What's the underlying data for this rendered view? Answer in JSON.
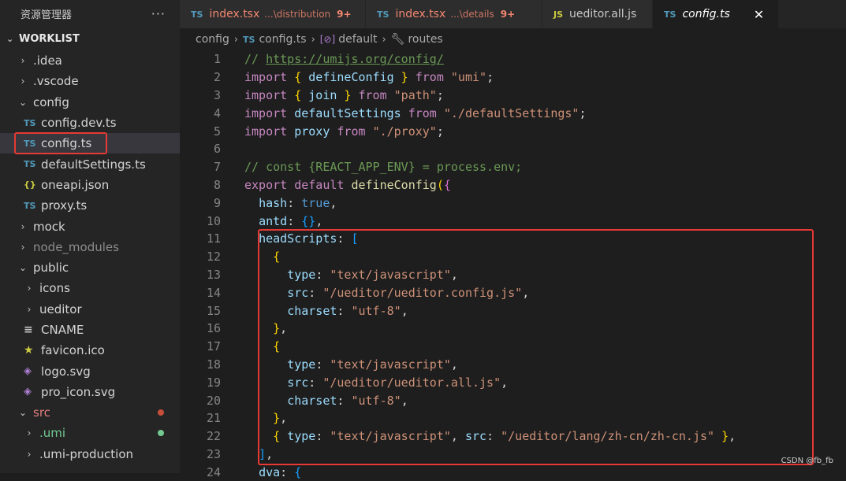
{
  "explorer": {
    "title": "资源管理器",
    "more": "···",
    "root": "WORKLIST",
    "items": [
      {
        "label": ".idea",
        "type": "folder",
        "depth": 1,
        "open": false
      },
      {
        "label": ".vscode",
        "type": "folder",
        "depth": 1,
        "open": false
      },
      {
        "label": "config",
        "type": "folder",
        "depth": 1,
        "open": true
      },
      {
        "label": "config.dev.ts",
        "type": "ts",
        "depth": 2
      },
      {
        "label": "config.ts",
        "type": "ts",
        "depth": 2,
        "selected": true
      },
      {
        "label": "defaultSettings.ts",
        "type": "ts",
        "depth": 2
      },
      {
        "label": "oneapi.json",
        "type": "json",
        "depth": 2
      },
      {
        "label": "proxy.ts",
        "type": "ts",
        "depth": 2
      },
      {
        "label": "mock",
        "type": "folder",
        "depth": 1,
        "open": false
      },
      {
        "label": "node_modules",
        "type": "folder",
        "depth": 1,
        "open": false,
        "dim": true
      },
      {
        "label": "public",
        "type": "folder",
        "depth": 1,
        "open": true
      },
      {
        "label": "icons",
        "type": "folder",
        "depth": 2,
        "open": false
      },
      {
        "label": "ueditor",
        "type": "folder",
        "depth": 2,
        "open": false
      },
      {
        "label": "CNAME",
        "type": "file",
        "depth": 2
      },
      {
        "label": "favicon.ico",
        "type": "star",
        "depth": 2
      },
      {
        "label": "logo.svg",
        "type": "svg",
        "depth": 2
      },
      {
        "label": "pro_icon.svg",
        "type": "svg",
        "depth": 2
      },
      {
        "label": "src",
        "type": "folder",
        "depth": 1,
        "open": true,
        "color": "red",
        "dot": "#c74e39"
      },
      {
        "label": ".umi",
        "type": "folder",
        "depth": 2,
        "open": false,
        "color": "green",
        "dot": "#73c991"
      },
      {
        "label": ".umi-production",
        "type": "folder",
        "depth": 2,
        "open": false
      }
    ]
  },
  "tabs": [
    {
      "icon": "TS",
      "name": "index.tsx",
      "path": "...\\distribution",
      "badge": "9+",
      "state": "error"
    },
    {
      "icon": "TS",
      "name": "index.tsx",
      "path": "...\\details",
      "badge": "9+",
      "state": "error"
    },
    {
      "icon": "JS",
      "name": "ueditor.all.js",
      "path": "",
      "badge": "",
      "state": "plain"
    },
    {
      "icon": "TS",
      "name": "config.ts",
      "path": "",
      "badge": "",
      "state": "active",
      "close": "✕"
    }
  ],
  "breadcrumb": {
    "folder": "config",
    "file_icon": "TS",
    "file": "config.ts",
    "symbol_icon": "[⊘]",
    "symbol": "default",
    "prop": "routes"
  },
  "code_lines": [
    {
      "n": "1",
      "tokens": [
        [
          "cm",
          "// "
        ],
        [
          "url",
          "https://umijs.org/config/"
        ]
      ]
    },
    {
      "n": "2",
      "tokens": [
        [
          "kw",
          "import "
        ],
        [
          "b1",
          "{ "
        ],
        [
          "id",
          "defineConfig"
        ],
        [
          "b1",
          " }"
        ],
        [
          "kw",
          " from "
        ],
        [
          "str",
          "\"umi\""
        ],
        [
          "code",
          ";"
        ]
      ]
    },
    {
      "n": "3",
      "tokens": [
        [
          "kw",
          "import "
        ],
        [
          "b1",
          "{ "
        ],
        [
          "id",
          "join"
        ],
        [
          "b1",
          " }"
        ],
        [
          "kw",
          " from "
        ],
        [
          "str",
          "\"path\""
        ],
        [
          "code",
          ";"
        ]
      ]
    },
    {
      "n": "4",
      "tokens": [
        [
          "kw",
          "import "
        ],
        [
          "id",
          "defaultSettings"
        ],
        [
          "kw",
          " from "
        ],
        [
          "str",
          "\"./defaultSettings\""
        ],
        [
          "code",
          ";"
        ]
      ]
    },
    {
      "n": "5",
      "tokens": [
        [
          "kw",
          "import "
        ],
        [
          "id",
          "proxy"
        ],
        [
          "kw",
          " from "
        ],
        [
          "str",
          "\"./proxy\""
        ],
        [
          "code",
          ";"
        ]
      ]
    },
    {
      "n": "6",
      "tokens": []
    },
    {
      "n": "7",
      "tokens": [
        [
          "cm",
          "// const {REACT_APP_ENV} = process.env;"
        ]
      ]
    },
    {
      "n": "8",
      "tokens": [
        [
          "kw",
          "export default "
        ],
        [
          "fn",
          "defineConfig"
        ],
        [
          "b1",
          "("
        ],
        [
          "b2",
          "{"
        ]
      ]
    },
    {
      "n": "9",
      "tokens": [
        [
          "code",
          "  "
        ],
        [
          "prop",
          "hash"
        ],
        [
          "code",
          ": "
        ],
        [
          "bool",
          "true"
        ],
        [
          "code",
          ","
        ]
      ]
    },
    {
      "n": "10",
      "tokens": [
        [
          "code",
          "  "
        ],
        [
          "prop",
          "antd"
        ],
        [
          "code",
          ": "
        ],
        [
          "b3",
          "{}"
        ],
        [
          "code",
          ","
        ]
      ]
    },
    {
      "n": "11",
      "tokens": [
        [
          "code",
          "  "
        ],
        [
          "prop",
          "headScripts"
        ],
        [
          "code",
          ": "
        ],
        [
          "b3",
          "["
        ]
      ]
    },
    {
      "n": "12",
      "tokens": [
        [
          "code",
          "    "
        ],
        [
          "b1",
          "{"
        ]
      ]
    },
    {
      "n": "13",
      "tokens": [
        [
          "code",
          "      "
        ],
        [
          "prop",
          "type"
        ],
        [
          "code",
          ": "
        ],
        [
          "str",
          "\"text/javascript\""
        ],
        [
          "code",
          ","
        ]
      ]
    },
    {
      "n": "14",
      "tokens": [
        [
          "code",
          "      "
        ],
        [
          "prop",
          "src"
        ],
        [
          "code",
          ": "
        ],
        [
          "str",
          "\"/ueditor/ueditor.config.js\""
        ],
        [
          "code",
          ","
        ]
      ]
    },
    {
      "n": "15",
      "tokens": [
        [
          "code",
          "      "
        ],
        [
          "prop",
          "charset"
        ],
        [
          "code",
          ": "
        ],
        [
          "str",
          "\"utf-8\""
        ],
        [
          "code",
          ","
        ]
      ]
    },
    {
      "n": "16",
      "tokens": [
        [
          "code",
          "    "
        ],
        [
          "b1",
          "}"
        ],
        [
          "code",
          ","
        ]
      ]
    },
    {
      "n": "17",
      "tokens": [
        [
          "code",
          "    "
        ],
        [
          "b1",
          "{"
        ]
      ]
    },
    {
      "n": "18",
      "tokens": [
        [
          "code",
          "      "
        ],
        [
          "prop",
          "type"
        ],
        [
          "code",
          ": "
        ],
        [
          "str",
          "\"text/javascript\""
        ],
        [
          "code",
          ","
        ]
      ]
    },
    {
      "n": "19",
      "tokens": [
        [
          "code",
          "      "
        ],
        [
          "prop",
          "src"
        ],
        [
          "code",
          ": "
        ],
        [
          "str",
          "\"/ueditor/ueditor.all.js\""
        ],
        [
          "code",
          ","
        ]
      ]
    },
    {
      "n": "20",
      "tokens": [
        [
          "code",
          "      "
        ],
        [
          "prop",
          "charset"
        ],
        [
          "code",
          ": "
        ],
        [
          "str",
          "\"utf-8\""
        ],
        [
          "code",
          ","
        ]
      ]
    },
    {
      "n": "21",
      "tokens": [
        [
          "code",
          "    "
        ],
        [
          "b1",
          "}"
        ],
        [
          "code",
          ","
        ]
      ]
    },
    {
      "n": "22",
      "tokens": [
        [
          "code",
          "    "
        ],
        [
          "b1",
          "{ "
        ],
        [
          "prop",
          "type"
        ],
        [
          "code",
          ": "
        ],
        [
          "str",
          "\"text/javascript\""
        ],
        [
          "code",
          ", "
        ],
        [
          "prop",
          "src"
        ],
        [
          "code",
          ": "
        ],
        [
          "str",
          "\"/ueditor/lang/zh-cn/zh-cn.js\""
        ],
        [
          "b1",
          " }"
        ],
        [
          "code",
          ","
        ]
      ]
    },
    {
      "n": "23",
      "tokens": [
        [
          "code",
          "  "
        ],
        [
          "b3",
          "]"
        ],
        [
          "code",
          ","
        ]
      ]
    },
    {
      "n": "24",
      "tokens": [
        [
          "code",
          "  "
        ],
        [
          "prop",
          "dva"
        ],
        [
          "code",
          ": "
        ],
        [
          "b3",
          "{"
        ]
      ]
    }
  ],
  "watermark": "CSDN @fb_fb",
  "colors": {
    "highlight": "#e53935",
    "accent": "#519aba"
  }
}
